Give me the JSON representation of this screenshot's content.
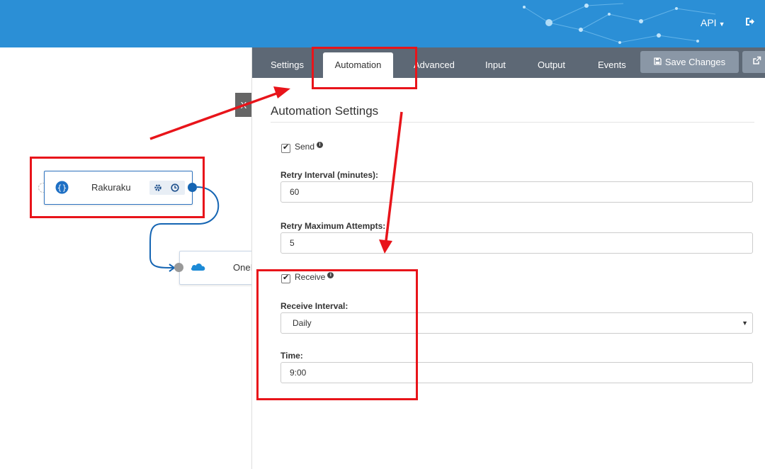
{
  "header": {
    "api_label": "API",
    "api_caret_icon": "caret-down-icon",
    "logout_icon": "sign-out-icon",
    "background_color": "#2b8fd6"
  },
  "canvas": {
    "nodes": [
      {
        "label": "Rakuraku",
        "icon": "braces-icon"
      },
      {
        "label": "OneDrive",
        "icon": "onedrive-cloud-icon",
        "visible_label": "OneI"
      }
    ],
    "rakuraku_actions": [
      "gear-icon",
      "clock-icon"
    ],
    "collapse_tab": "X"
  },
  "panel": {
    "tabs": [
      {
        "label": "Settings",
        "active": false
      },
      {
        "label": "Automation",
        "active": true
      },
      {
        "label": "Advanced",
        "active": false
      },
      {
        "label": "Input",
        "active": false
      },
      {
        "label": "Output",
        "active": false
      },
      {
        "label": "Events",
        "active": false
      }
    ],
    "save_label": "Save Changes",
    "save_icon": "floppy-disk-icon",
    "external_icon": "external-link-icon",
    "title": "Automation Settings",
    "send": {
      "label": "Send",
      "checked": true
    },
    "retry_interval": {
      "label": "Retry Interval (minutes):",
      "value": "60"
    },
    "retry_max": {
      "label": "Retry Maximum Attempts:",
      "value": "5"
    },
    "receive": {
      "label": "Receive",
      "checked": true
    },
    "receive_interval": {
      "label": "Receive Interval:",
      "value": "Daily",
      "options": [
        "Daily"
      ]
    },
    "time": {
      "label": "Time:",
      "value": "9:00"
    }
  },
  "annotation_color": "#e8141a"
}
